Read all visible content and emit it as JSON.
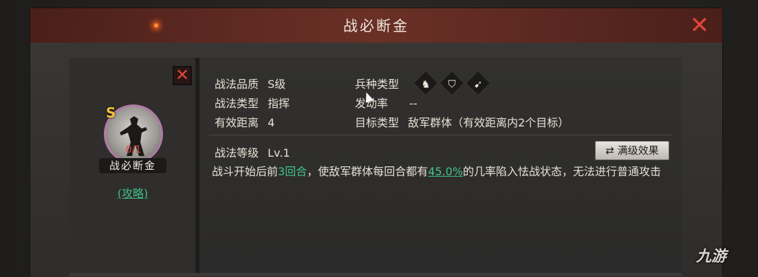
{
  "window": {
    "title": "战必断金"
  },
  "tactic": {
    "grade_badge": "S",
    "count": "0/1",
    "name": "战必断金",
    "guide_link": "(攻略)",
    "quality_label": "战法品质",
    "quality_value": "S级",
    "type_label": "战法类型",
    "type_value": "指挥",
    "range_label": "有效距离",
    "range_value": "4",
    "troop_label": "兵种类型",
    "troop_icons": [
      "cavalry-icon",
      "shield-icon",
      "bow-icon"
    ],
    "trigger_label": "发动率",
    "trigger_value": "--",
    "target_label": "目标类型",
    "target_value": "敌军群体（有效距离内2个目标）",
    "level_label": "战法等级",
    "level_value": "Lv.1",
    "max_effect_label": "满级效果",
    "desc_part1": "战斗开始后前",
    "desc_hl1": "3回合",
    "desc_part2": "，使敌军群体每回合都有",
    "desc_hl2": "45.0%",
    "desc_part3": "的几率陷入怯战状态，无法进行普通攻击"
  },
  "watermark": "九游",
  "colors": {
    "accent_green": "#3fc48a",
    "close_red": "#e0463a",
    "grade_gold": "#f3c23a"
  }
}
